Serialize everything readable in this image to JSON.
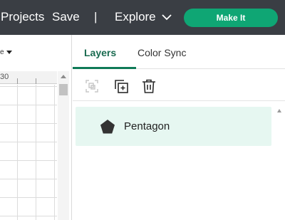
{
  "header": {
    "projects_label": "Projects",
    "save_label": "Save",
    "separator": "|",
    "explore_label": "Explore",
    "explore_icon": "chevron-down-icon",
    "make_label": "Make It"
  },
  "canvas": {
    "dropdown_partial": "e",
    "ruler_value": "30"
  },
  "panel": {
    "tabs": [
      {
        "label": "Layers",
        "active": true
      },
      {
        "label": "Color Sync",
        "active": false
      }
    ],
    "tools": [
      {
        "name": "group-icon",
        "enabled": false
      },
      {
        "name": "duplicate-icon",
        "enabled": true
      },
      {
        "name": "delete-icon",
        "enabled": true
      }
    ],
    "layers": [
      {
        "name": "Pentagon",
        "icon": "pentagon-icon",
        "selected": true
      }
    ]
  },
  "colors": {
    "header_bg": "#3a3e44",
    "accent": "#0fa674",
    "selected_row": "#e6f7f1"
  }
}
